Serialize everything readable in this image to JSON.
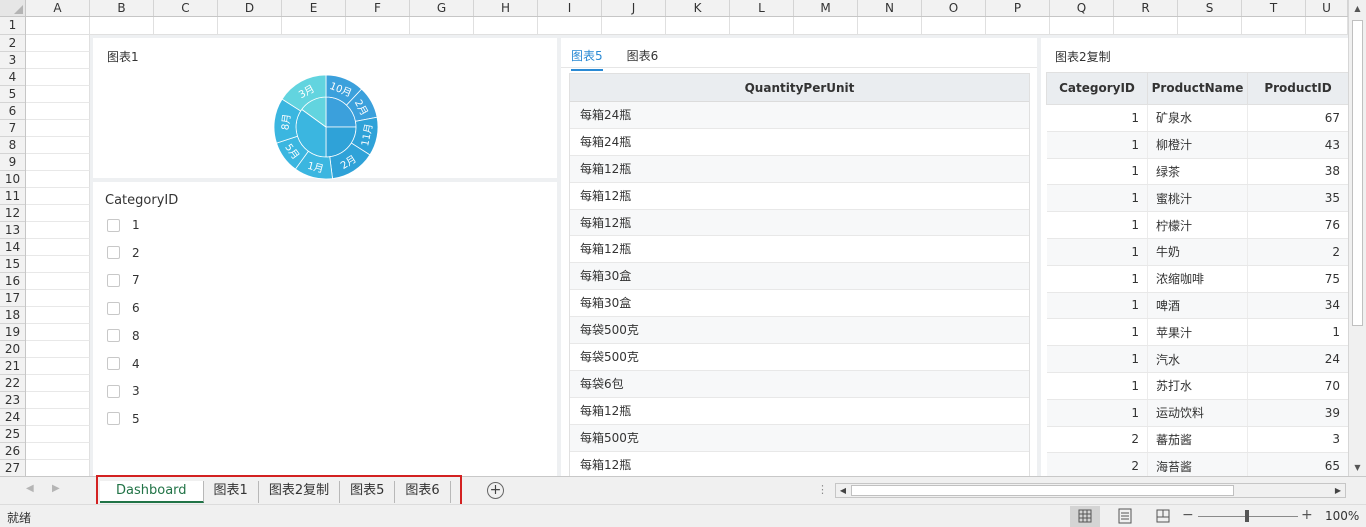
{
  "columns": [
    "A",
    "B",
    "C",
    "D",
    "E",
    "F",
    "G",
    "H",
    "I",
    "J",
    "K",
    "L",
    "M",
    "N",
    "O",
    "P",
    "Q",
    "R",
    "S",
    "T",
    "U"
  ],
  "rows": [
    "1",
    "2",
    "3",
    "4",
    "5",
    "6",
    "7",
    "8",
    "9",
    "10",
    "11",
    "12",
    "13",
    "14",
    "15",
    "16",
    "17",
    "18",
    "19",
    "20",
    "21",
    "22",
    "23",
    "24",
    "25",
    "26",
    "27"
  ],
  "chart1": {
    "title": "图表1",
    "chart_data": {
      "type": "pie",
      "rings": [
        {
          "slices": [
            {
              "label": "",
              "value": 25,
              "color": "#3ba0dc"
            },
            {
              "label": "",
              "value": 25,
              "color": "#2fa2d8"
            },
            {
              "label": "",
              "value": 35,
              "color": "#3bb6e0"
            },
            {
              "label": "",
              "value": 15,
              "color": "#62d4df"
            }
          ]
        },
        {
          "slices": [
            {
              "label": "10月",
              "value": 12
            },
            {
              "label": "2月",
              "value": 10
            },
            {
              "label": "11月",
              "value": 12
            },
            {
              "label": "2月",
              "value": 14
            },
            {
              "label": "1月",
              "value": 12
            },
            {
              "label": "5月",
              "value": 10
            },
            {
              "label": "8月",
              "value": 14
            },
            {
              "label": "3月",
              "value": 16
            }
          ]
        }
      ]
    }
  },
  "filter": {
    "title": "CategoryID",
    "options": [
      "1",
      "2",
      "7",
      "6",
      "8",
      "4",
      "3",
      "5"
    ]
  },
  "table5": {
    "tabs": [
      "图表5",
      "图表6"
    ],
    "header": "QuantityPerUnit",
    "rows": [
      "每箱24瓶",
      "每箱24瓶",
      "每箱12瓶",
      "每箱12瓶",
      "每箱12瓶",
      "每箱12瓶",
      "每箱30盒",
      "每箱30盒",
      "每袋500克",
      "每袋500克",
      "每袋6包",
      "每箱12瓶",
      "每箱500克",
      "每箱12瓶"
    ]
  },
  "table2": {
    "title": "图表2复制",
    "headers": [
      "CategoryID",
      "ProductName",
      "ProductID"
    ],
    "rows": [
      [
        "1",
        "矿泉水",
        "67"
      ],
      [
        "1",
        "柳橙汁",
        "43"
      ],
      [
        "1",
        "绿茶",
        "38"
      ],
      [
        "1",
        "蜜桃汁",
        "35"
      ],
      [
        "1",
        "柠檬汁",
        "76"
      ],
      [
        "1",
        "牛奶",
        "2"
      ],
      [
        "1",
        "浓缩咖啡",
        "75"
      ],
      [
        "1",
        "啤酒",
        "34"
      ],
      [
        "1",
        "苹果汁",
        "1"
      ],
      [
        "1",
        "汽水",
        "24"
      ],
      [
        "1",
        "苏打水",
        "70"
      ],
      [
        "1",
        "运动饮料",
        "39"
      ],
      [
        "2",
        "蕃茄酱",
        "3"
      ],
      [
        "2",
        "海苔酱",
        "65"
      ]
    ]
  },
  "sheet_tabs": [
    "Dashboard",
    "图表1",
    "图表2复制",
    "图表5",
    "图表6"
  ],
  "active_sheet": "Dashboard",
  "status": {
    "text": "就绪",
    "zoom": "100%"
  },
  "icons": {
    "add_sheet": "plus-circle-icon",
    "normal_view": "grid-view-icon",
    "page_layout": "page-layout-icon",
    "page_break": "page-break-icon"
  },
  "colors": {
    "accent_green": "#217346",
    "tab_highlight": "#d32121",
    "link_blue": "#2a8ad4"
  }
}
